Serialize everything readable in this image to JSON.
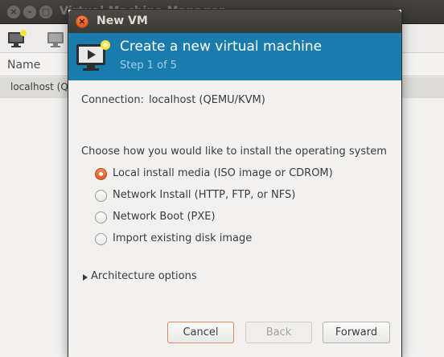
{
  "background_window": {
    "title": "Virtual Machine Manager",
    "column_name": "Name",
    "row_text": "localhost (QEMU)"
  },
  "dialog": {
    "title": "New VM",
    "banner_title": "Create a new virtual machine",
    "banner_step": "Step 1 of 5",
    "connection_label": "Connection:",
    "connection_value": "localhost (QEMU/KVM)",
    "choose_label": "Choose how you would like to install the operating system",
    "options": [
      {
        "label": "Local install media (ISO image or CDROM)",
        "checked": true
      },
      {
        "label": "Network Install (HTTP, FTP, or NFS)",
        "checked": false
      },
      {
        "label": "Network Boot (PXE)",
        "checked": false
      },
      {
        "label": "Import existing disk image",
        "checked": false
      }
    ],
    "architecture_label": "Architecture options",
    "buttons": {
      "cancel": "Cancel",
      "back": "Back",
      "forward": "Forward"
    }
  },
  "colors": {
    "banner": "#1a7cad",
    "accent_orange": "#e05a23"
  },
  "icons": {
    "banner": "monitor-new-vm-icon",
    "toolbar_new": "new-vm-icon",
    "toolbar_open": "monitor-icon",
    "expander": "triangle-right-icon"
  }
}
